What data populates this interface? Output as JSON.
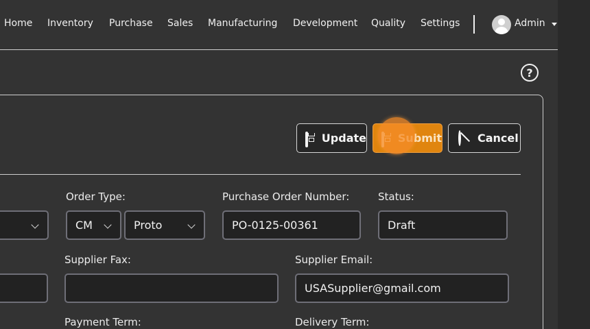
{
  "nav": {
    "items": [
      {
        "label": "Home"
      },
      {
        "label": "Inventory"
      },
      {
        "label": "Purchase"
      },
      {
        "label": "Sales"
      },
      {
        "label": "Manufacturing"
      },
      {
        "label": "Development"
      },
      {
        "label": "Quality"
      },
      {
        "label": "Settings"
      }
    ],
    "user": "Admin"
  },
  "help_icon": "question-circle-icon",
  "actions": {
    "update_label": "Update",
    "submit_label": "Submit",
    "cancel_label": "Cancel"
  },
  "form": {
    "order_type_label": "Order Type:",
    "order_type_prefix": "CM",
    "order_type_value": "Proto",
    "po_number_label": "Purchase Order Number:",
    "po_number_value": "PO-0125-00361",
    "status_label": "Status:",
    "status_value": "Draft",
    "supplier_fax_label": "Supplier Fax:",
    "supplier_fax_value": "",
    "supplier_email_label": "Supplier Email:",
    "supplier_email_value": "USASupplier@gmail.com",
    "payment_term_label": "Payment Term:",
    "delivery_term_label": "Delivery Term:"
  },
  "colors": {
    "background": "#333333",
    "accent": "#e0850f"
  }
}
